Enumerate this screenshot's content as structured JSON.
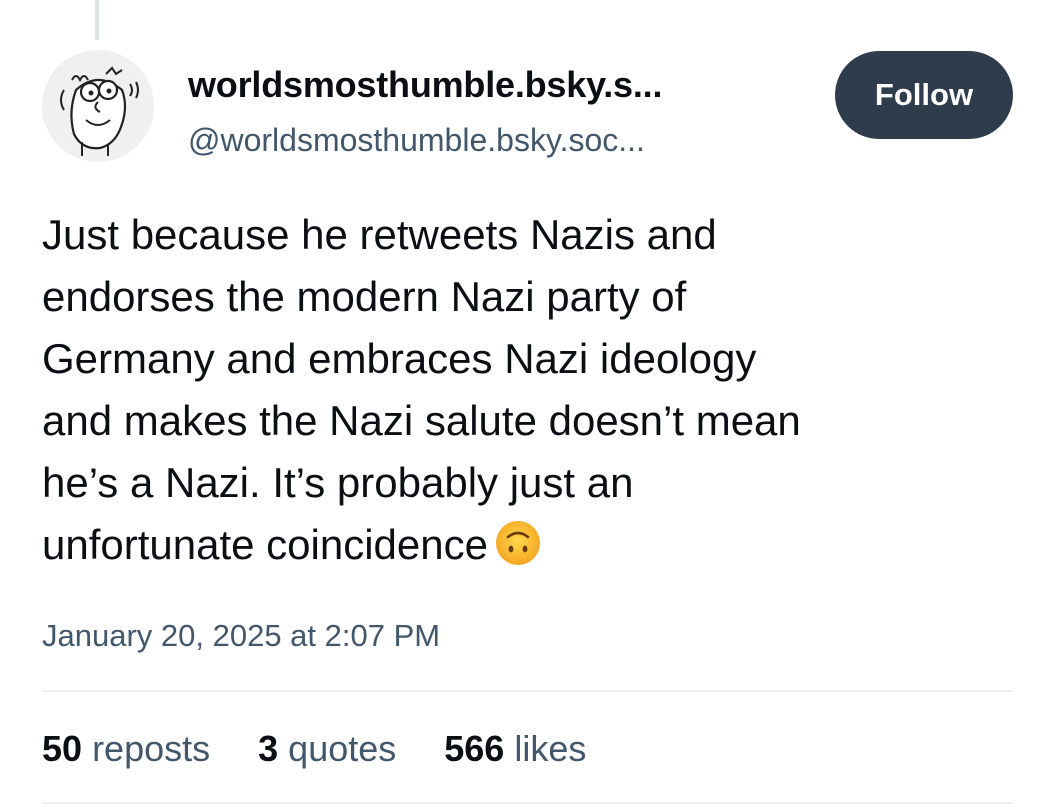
{
  "post": {
    "author": {
      "display_name": "worldsmosthumble.bsky.s...",
      "handle": "@worldsmosthumble.bsky.soc..."
    },
    "follow_label": "Follow",
    "text_lines": [
      "Just because he retweets Nazis and",
      "endorses the modern Nazi party of",
      "Germany and embraces Nazi ideology",
      "and makes the Nazi salute doesn’t mean",
      "he’s a Nazi. It’s probably just an",
      "unfortunate coincidence"
    ],
    "emoji": "upside-down-face-emoji",
    "timestamp": "January 20, 2025 at 2:07 PM",
    "stats": {
      "reposts_count": "50",
      "reposts_label": "reposts",
      "quotes_count": "3",
      "quotes_label": "quotes",
      "likes_count": "566",
      "likes_label": "likes"
    }
  },
  "colors": {
    "follow_button_bg": "#2e3c4b",
    "secondary_text": "#42576c",
    "primary_text": "#0b0f14"
  }
}
